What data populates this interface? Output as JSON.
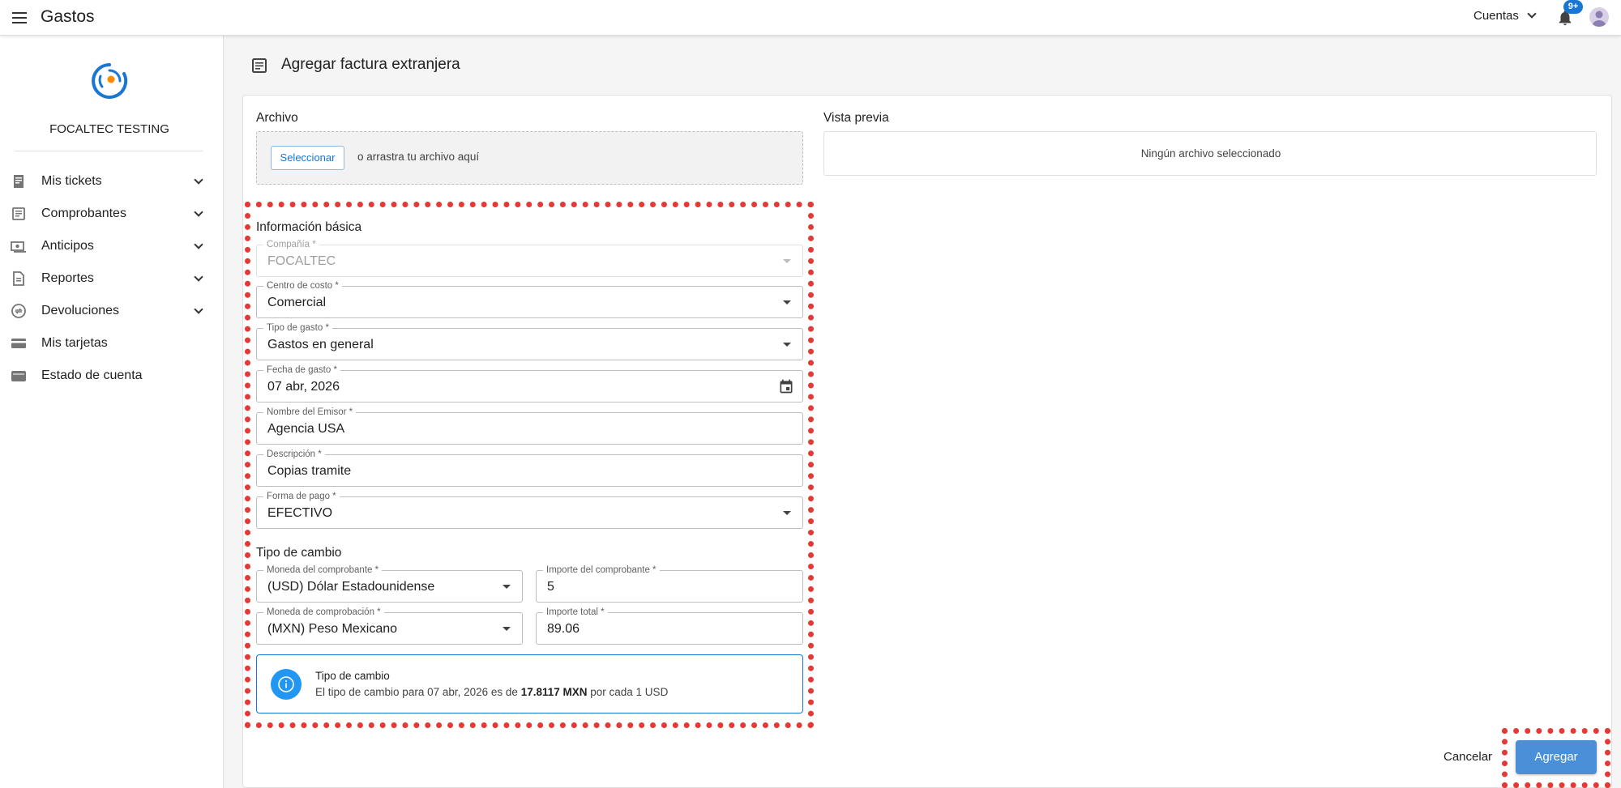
{
  "app": {
    "title": "Gastos"
  },
  "header": {
    "accounts_label": "Cuentas",
    "notifications_badge": "9+"
  },
  "sidebar": {
    "company": "FOCALTEC TESTING",
    "items": [
      {
        "label": "Mis tickets",
        "icon": "receipt-icon",
        "expandable": true
      },
      {
        "label": "Comprobantes",
        "icon": "document-icon",
        "expandable": true
      },
      {
        "label": "Anticipos",
        "icon": "cash-icon",
        "expandable": true
      },
      {
        "label": "Reportes",
        "icon": "report-icon",
        "expandable": true
      },
      {
        "label": "Devoluciones",
        "icon": "refund-icon",
        "expandable": true
      },
      {
        "label": "Mis tarjetas",
        "icon": "credit-card-icon",
        "expandable": false
      },
      {
        "label": "Estado de cuenta",
        "icon": "wallet-icon",
        "expandable": false
      }
    ]
  },
  "page": {
    "title": "Agregar factura extranjera"
  },
  "file": {
    "label": "Archivo",
    "select_button": "Seleccionar",
    "drop_hint": "o arrastra tu archivo aquí"
  },
  "preview": {
    "label": "Vista previa",
    "empty_text": "Ningún archivo seleccionado"
  },
  "basic_info": {
    "title": "Información básica",
    "company": {
      "label": "Compañía *",
      "value": "FOCALTEC"
    },
    "cost_center": {
      "label": "Centro de costo *",
      "value": "Comercial"
    },
    "expense_type": {
      "label": "Tipo de gasto *",
      "value": "Gastos en general"
    },
    "expense_date": {
      "label": "Fecha de gasto *",
      "value": "07 abr, 2026"
    },
    "issuer_name": {
      "label": "Nombre del Emisor *",
      "value": "Agencia USA"
    },
    "description": {
      "label": "Descripción *",
      "value": "Copias tramite"
    },
    "payment_method": {
      "label": "Forma de pago *",
      "value": "EFECTIVO"
    }
  },
  "exchange": {
    "title": "Tipo de cambio",
    "invoice_currency": {
      "label": "Moneda del comprobante *",
      "value": "(USD) Dólar Estadounidense"
    },
    "invoice_amount": {
      "label": "Importe del comprobante *",
      "value": "5"
    },
    "proof_currency": {
      "label": "Moneda de comprobación *",
      "value": "(MXN) Peso Mexicano"
    },
    "total_amount": {
      "label": "Importe total *",
      "value": "89.06"
    },
    "info_title": "Tipo de cambio",
    "info_prefix": "El tipo de cambio para 07 abr, 2026 es de",
    "info_rate": "17.8117 MXN",
    "info_suffix": "por cada 1 USD"
  },
  "actions": {
    "cancel": "Cancelar",
    "add": "Agregar"
  },
  "colors": {
    "primary": "#1976d2",
    "highlight": "#e53935",
    "button": "#4a90d9"
  }
}
